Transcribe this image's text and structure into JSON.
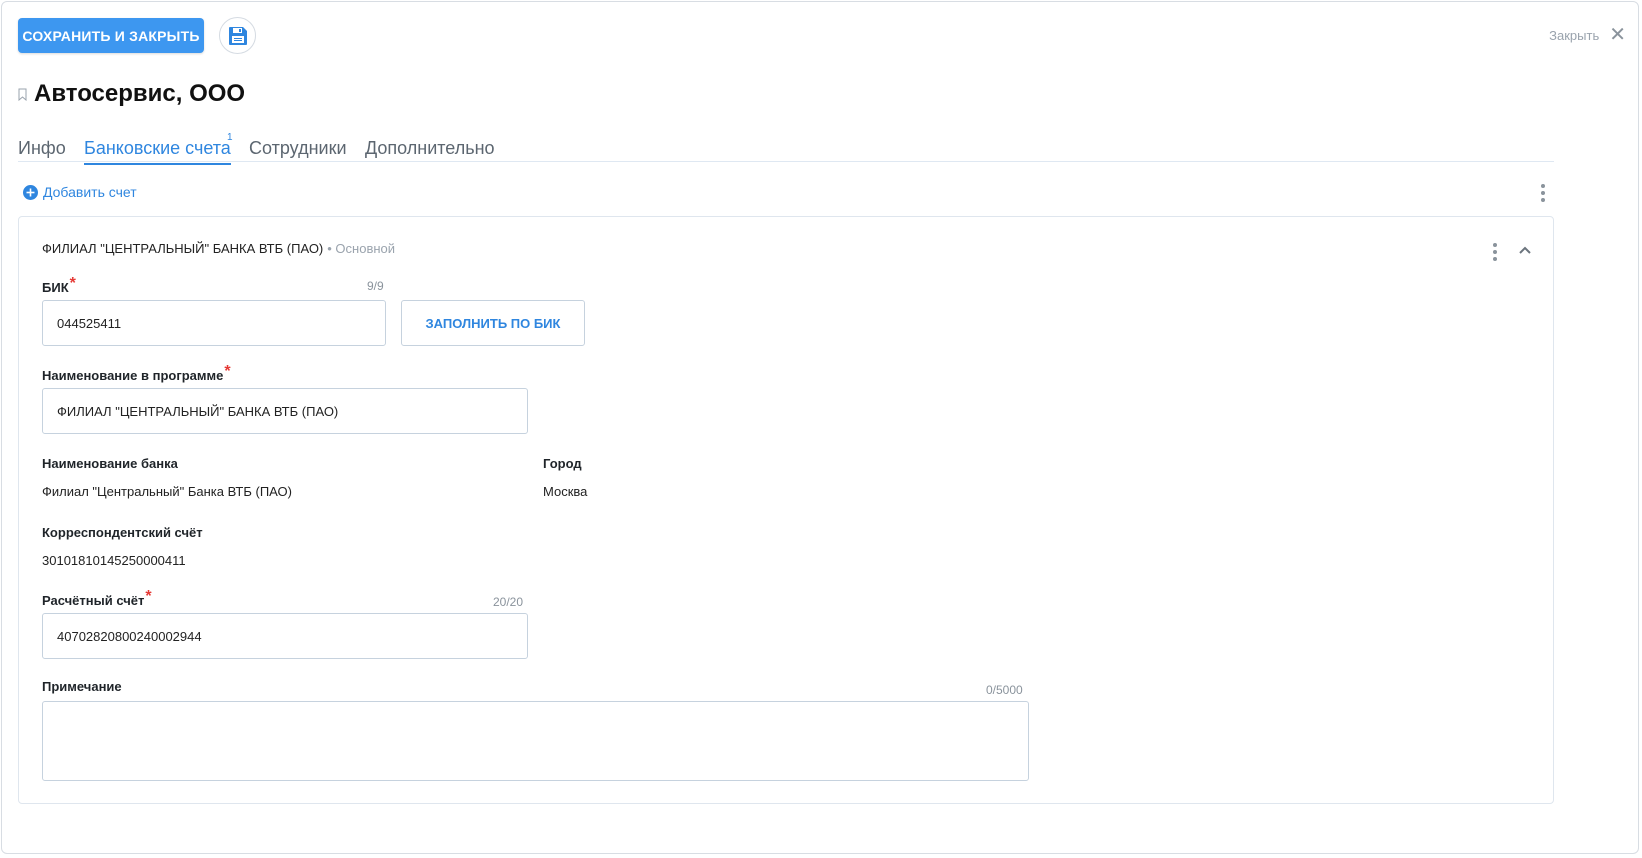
{
  "toolbar": {
    "save_close_label": "СОХРАНИТЬ И ЗАКРЫТЬ",
    "save_icon": "floppy-disk-icon",
    "close_label": "Закрыть"
  },
  "header": {
    "title": "Автосервис, ООО"
  },
  "tabs": [
    {
      "label": "Инфо",
      "active": false
    },
    {
      "label": "Банковские счета",
      "active": true,
      "badge": "1"
    },
    {
      "label": "Сотрудники",
      "active": false
    },
    {
      "label": "Дополнительно",
      "active": false
    }
  ],
  "accounts": {
    "add_label": "Добавить счет"
  },
  "card": {
    "bank_title": "ФИЛИАЛ \"ЦЕНТРАЛЬНЫЙ\" БАНКА ВТБ (ПАО)",
    "status": "• Основной",
    "bik": {
      "label": "БИК",
      "counter": "9/9",
      "value": "044525411",
      "fill_button": "ЗАПОЛНИТЬ ПО БИК"
    },
    "program_name": {
      "label": "Наименование в программе",
      "value": "ФИЛИАЛ \"ЦЕНТРАЛЬНЫЙ\" БАНКА ВТБ (ПАО)"
    },
    "bank_name": {
      "label": "Наименование банка",
      "value": "Филиал \"Центральный\" Банка ВТБ (ПАО)"
    },
    "city": {
      "label": "Город",
      "value": "Москва"
    },
    "corr_account": {
      "label": "Корреспондентский счёт",
      "value": "30101810145250000411"
    },
    "settlement_account": {
      "label": "Расчётный счёт",
      "counter": "20/20",
      "value": "40702820800240002944"
    },
    "note": {
      "label": "Примечание",
      "counter": "0/5000",
      "value": ""
    }
  },
  "colors": {
    "accent": "#3d97f0",
    "link": "#2f86df",
    "required": "#e53935",
    "muted": "#9aa3ad"
  }
}
